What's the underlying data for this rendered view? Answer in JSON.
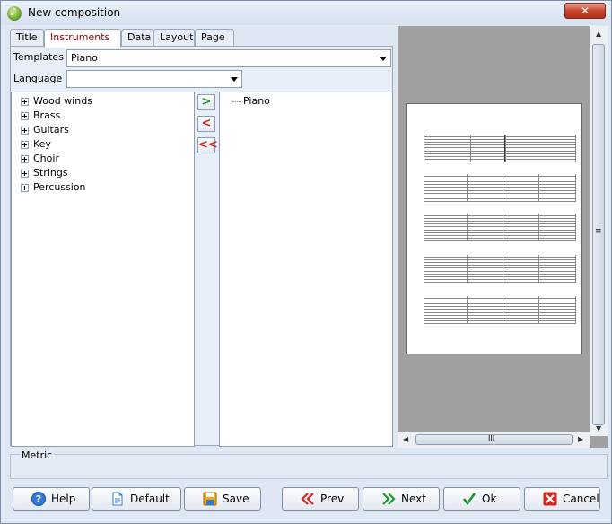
{
  "window": {
    "title": "New composition",
    "close_glyph": "✕"
  },
  "tabs": [
    "Title",
    "Instruments",
    "Data",
    "Layout",
    "Page"
  ],
  "active_tab": "Instruments",
  "templates": {
    "label": "Templates",
    "value": "Piano"
  },
  "language": {
    "label": "Language",
    "value": ""
  },
  "instrument_groups": [
    "Wood winds",
    "Brass",
    "Guitars",
    "Key",
    "Choir",
    "Strings",
    "Percussion"
  ],
  "move_buttons": {
    "add": ">",
    "remove": "<",
    "remove_all": "<<"
  },
  "selected_instruments": [
    "Piano"
  ],
  "metric": {
    "label": "Metric"
  },
  "scroll": {
    "grip": "≡",
    "hgrip": "III",
    "up": "▲",
    "down": "▼",
    "left": "◀",
    "right": "▶"
  },
  "buttons": {
    "help": "Help",
    "default": "Default",
    "save": "Save",
    "prev": "Prev",
    "next": "Next",
    "ok": "Ok",
    "cancel": "Cancel"
  },
  "colors": {
    "active_tab_text": "#8b0000",
    "accent_green": "#1a9a2a",
    "accent_red": "#d0281e"
  }
}
